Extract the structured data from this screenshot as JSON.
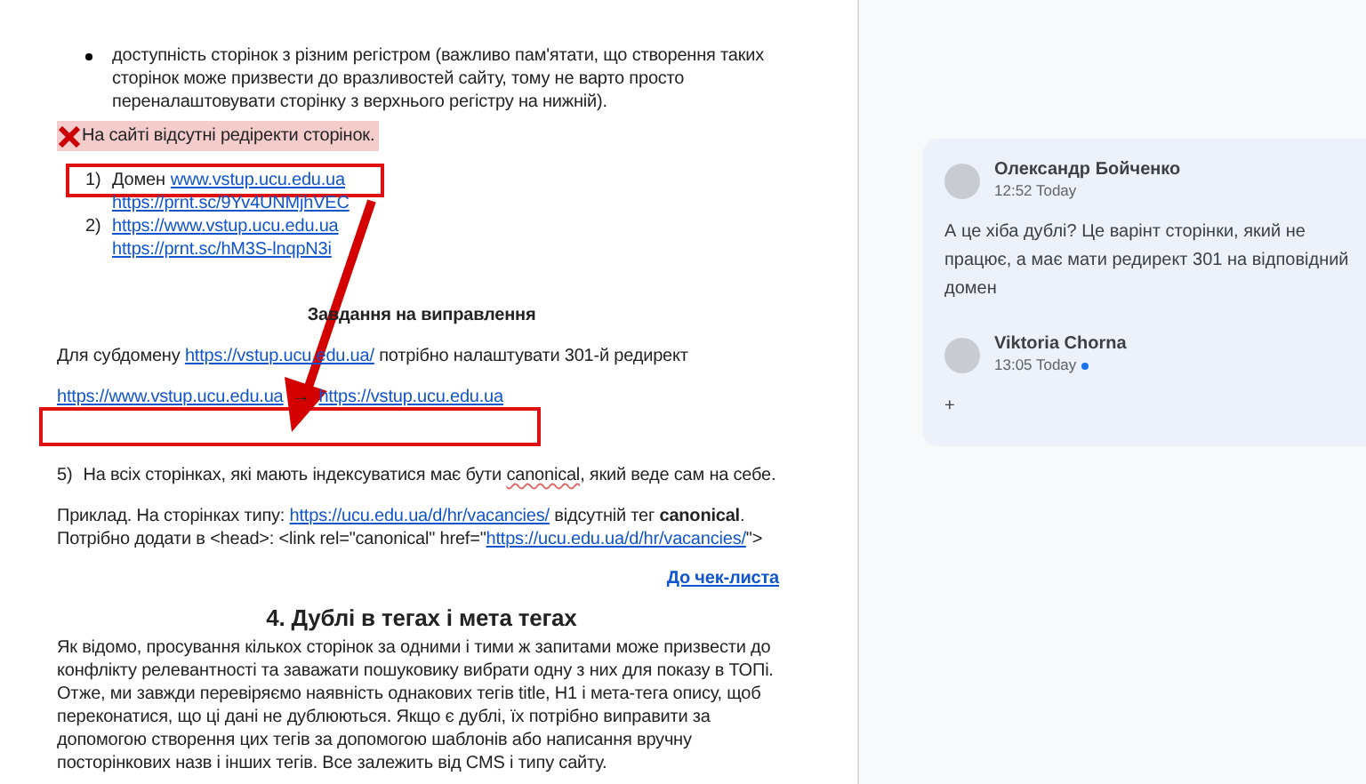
{
  "document": {
    "bullet_items": [
      "доступність сторінок з різним регістром (важливо пам'ятати, що створення таких сторінок може призвести до вразливостей сайту, тому не варто просто переналаштовувати сторінку з верхнього регістру на нижній)."
    ],
    "issue": {
      "text": "На сайті відсутні редіректи сторінок.",
      "highlighted": true
    },
    "numbered_list": [
      {
        "number": "1)",
        "label": "Домен",
        "links": [
          "www.vstup.ucu.edu.ua",
          "https://prnt.sc/9Yv4UNMjhVEC"
        ]
      },
      {
        "number": "2)",
        "links": [
          "https://www.vstup.ucu.edu.ua",
          "https://prnt.sc/hM3S-lnqpN3i"
        ]
      }
    ],
    "fix_heading": "Завдання на виправлення",
    "fix_text": {
      "before": "Для субдомену",
      "link": "https://vstup.ucu.edu.ua/",
      "after": "потрібно налаштувати 301-й редирект"
    },
    "redirect": {
      "from": "https://www.vstup.ucu.edu.ua",
      "arrow": "→",
      "to": "https://vstup.ucu.edu.ua"
    },
    "point5": {
      "number": "5)",
      "before": "На всіх сторінках, які мають індексуватися має бути",
      "flagged_word": "canonical",
      "after": ", який веде сам на себе."
    },
    "example": {
      "line1_before": "Приклад. На сторінках типу:",
      "line1_link": "https://ucu.edu.ua/d/hr/vacancies/",
      "line1_after": "відсутній тег **canonical**.",
      "line2_before": "Потрібно додати в <head>: <link rel=\"canonical\" href=\"",
      "line2_link": "https://ucu.edu.ua/d/hr/vacancies/",
      "line2_after": "\">"
    },
    "checklist_link": "До чек-листа",
    "section_heading": "4. Дублі в тегах і мета тегах",
    "paragraph": "Як відомо, просування кількох сторінок за одними і тими ж запитами може призвести до конфлікту релевантності та заважати пошуковику вибрати одну з них для показу в ТОПі. Отже, ми завжди перевіряємо наявність однакових тегів title, H1 і мета-тега опису, щоб переконатися, що ці дані не дублюються. Якщо є дублі, їх потрібно виправити за допомогою створення цих тегів за допомогою шаблонів або написання вручну посторінкових назв і інших тегів. Все залежить від CMS і типу сайту."
  },
  "comments": [
    {
      "author": "Олександр Бойченко",
      "time": "12:52 Today",
      "unread": false,
      "text": "А це хіба дублі? Це варінт сторінки, який не працює, а має мати редирект 301 на відповідний домен"
    },
    {
      "author": "Viktoria Chorna",
      "time": "13:05 Today",
      "unread": true,
      "text": "+"
    }
  ]
}
